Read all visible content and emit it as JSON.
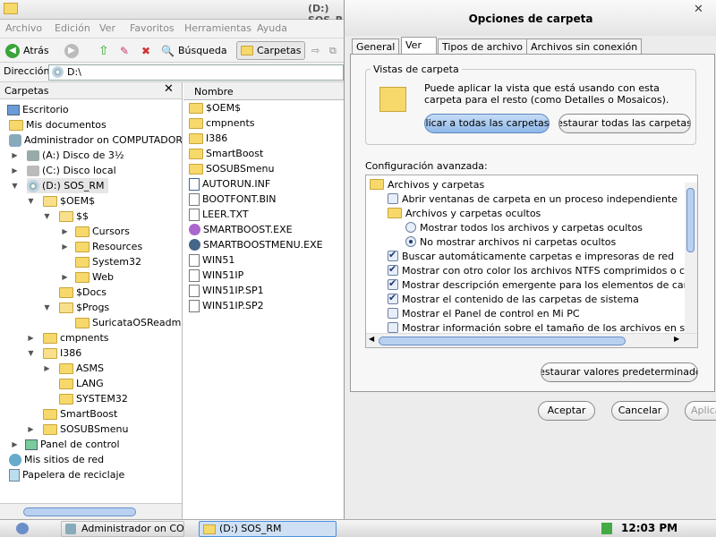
{
  "explorer": {
    "title": "(D:) SOS_RM",
    "menu": [
      "Archivo",
      "Edición",
      "Ver",
      "Favoritos",
      "Herramientas",
      "Ayuda"
    ],
    "toolbar": {
      "back": "Atrás",
      "search": "Búsqueda",
      "folders": "Carpetas"
    },
    "address_label": "Dirección",
    "address_value": "D:\\",
    "tree_header": "Carpetas",
    "tree": {
      "desktop": "Escritorio",
      "mydocs": "Mis documentos",
      "admin": "Administrador on COMPUTADORA",
      "floppy": "(A:) Disco de 3½",
      "c": "(C:) Disco local",
      "d": "(D:) SOS_RM",
      "oem": "$OEM$",
      "ss": "$$",
      "cursors": "Cursors",
      "resources": "Resources",
      "system32": "System32",
      "web": "Web",
      "docs": "$Docs",
      "progs": "$Progs",
      "suricata": "SuricataOSReadme",
      "cmpnents": "cmpnents",
      "i386": "I386",
      "asms": "ASMS",
      "lang": "LANG",
      "system32b": "SYSTEM32",
      "smartboost": "SmartBoost",
      "sosubsmenu": "SOSUBSmenu",
      "panel": "Panel de control",
      "network": "Mis sitios de red",
      "recycle": "Papelera de reciclaje"
    },
    "files_header": "Nombre",
    "files": [
      "$OEM$",
      "cmpnents",
      "I386",
      "SmartBoost",
      "SOSUBSmenu",
      "AUTORUN.INF",
      "BOOTFONT.BIN",
      "LEER.TXT",
      "SMARTBOOST.EXE",
      "SMARTBOOSTMENU.EXE",
      "WIN51",
      "WIN51IP",
      "WIN51IP.SP1",
      "WIN51IP.SP2"
    ]
  },
  "dialog": {
    "title": "Opciones de carpeta",
    "tabs": [
      "General",
      "Ver",
      "Tipos de archivo",
      "Archivos sin conexión"
    ],
    "group_label": "Vistas de carpeta",
    "description": "Puede aplicar la vista que está usando con esta carpeta para el resto (como Detalles o Mosaicos).",
    "apply_all": "Aplicar a todas las carpetas",
    "reset_all": "Restaurar todas las carpetas",
    "advanced_label": "Configuración avanzada:",
    "items": {
      "files_folders": "Archivos y carpetas",
      "separate_process": "Abrir ventanas de carpeta en un proceso independiente",
      "hidden": "Archivos y carpetas ocultos",
      "show_hidden": "Mostrar todos los archivos y carpetas ocultos",
      "no_show_hidden": "No mostrar archivos ni carpetas ocultos",
      "printers": "Buscar automáticamente carpetas e impresoras de red",
      "ntfs": "Mostrar con otro color los archivos NTFS comprimidos o cifrados",
      "popup": "Mostrar descripción emergente para los elementos de carpeta y escritorio",
      "system": "Mostrar el contenido de las carpetas de sistema",
      "cpanel": "Mostrar el Panel de control en Mi PC",
      "size": "Mostrar información sobre el tamaño de los archivos en sugerencias"
    },
    "restore_defaults": "Restaurar valores predeterminados",
    "ok": "Aceptar",
    "cancel": "Cancelar",
    "apply": "Aplicar"
  },
  "taskbar": {
    "task1": "Administrador on COM...",
    "task2": "(D:) SOS_RM",
    "clock": "12:03 PM"
  }
}
